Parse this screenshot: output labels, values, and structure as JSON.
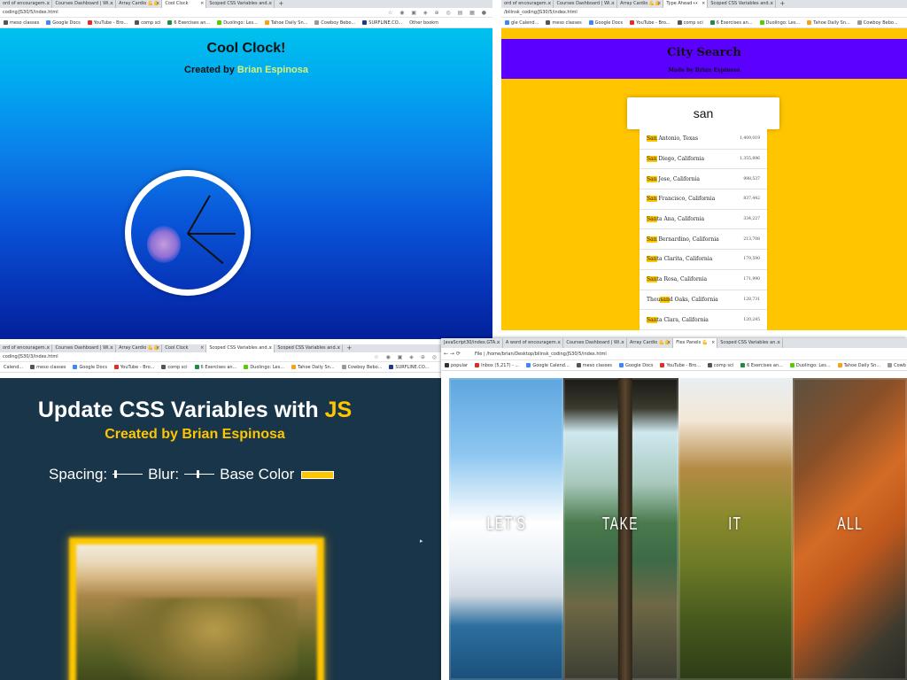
{
  "clock_window": {
    "tabs": [
      "ord of encouragem...",
      "Courses Dashboard | Wi...",
      "Array Cardio 💪💪",
      "Cool Clock",
      "Scoped CSS Variables and..."
    ],
    "active_tab": "Cool Clock",
    "url": "coding/JS30/5/index.html",
    "bookmarks": [
      "meso classes",
      "Google Docs",
      "YouTube - Bro...",
      "comp sci",
      "6 Exercises an...",
      "Duolingo: Les...",
      "Tahoe Daily Sn...",
      "Cowboy Bebo...",
      "SURFLINE.CO...",
      "Other bookm"
    ],
    "title": "Cool Clock!",
    "subtitle_prefix": "Created by ",
    "subtitle_name": "Brian Espinosa",
    "clock": {
      "hour_deg": -60,
      "minute_deg": 0,
      "second_deg": 40
    }
  },
  "city_window": {
    "tabs": [
      "ord of encouragem...",
      "Courses Dashboard | Wi...",
      "Array Cardio 💪💪",
      "Type Ahead 👀",
      "Scoped CSS Variables and..."
    ],
    "active_tab": "Type Ahead 👀",
    "url": "/bilinsk_coding/JS30/5/index.html",
    "bookmarks": [
      "gle Calend...",
      "meso classes",
      "Google Docs",
      "YouTube - Bro...",
      "comp sci",
      "6 Exercises an...",
      "Duolingo: Les...",
      "Tahoe Daily Sn...",
      "Cowboy Bebo..."
    ],
    "title": "City Search",
    "subtitle": "Made by Brian Espinosa",
    "search_value": "san",
    "results": [
      {
        "before": "",
        "match": "San",
        "after": " Antonio, Texas",
        "pop": "1,409,019"
      },
      {
        "before": "",
        "match": "San",
        "after": " Diego, California",
        "pop": "1,355,896"
      },
      {
        "before": "",
        "match": "San",
        "after": " Jose, California",
        "pop": "998,537"
      },
      {
        "before": "",
        "match": "San",
        "after": " Francisco, California",
        "pop": "837,442"
      },
      {
        "before": "",
        "match": "San",
        "after": "ta Ana, California",
        "pop": "334,227"
      },
      {
        "before": "",
        "match": "San",
        "after": " Bernardino, California",
        "pop": "213,708"
      },
      {
        "before": "",
        "match": "San",
        "after": "ta Clarita, California",
        "pop": "179,590"
      },
      {
        "before": "",
        "match": "San",
        "after": "ta Rosa, California",
        "pop": "171,990"
      },
      {
        "before": "Thou",
        "match": "san",
        "after": "d Oaks, California",
        "pop": "128,731"
      },
      {
        "before": "",
        "match": "San",
        "after": "ta Clara, California",
        "pop": "120,245"
      }
    ]
  },
  "vars_window": {
    "tabs": [
      "ord of encouragem...",
      "Courses Dashboard | Wi...",
      "Array Cardio 💪💪",
      "Cool Clock",
      "Scoped CSS Variables and...",
      "Scoped CSS Variables and..."
    ],
    "active_tab": "Scoped CSS Variables and...",
    "url": "coding/JS30/3/index.html",
    "bookmarks": [
      "Calend...",
      "meso classes",
      "Google Docs",
      "YouTube - Bro...",
      "comp sci",
      "6 Exercises an...",
      "Duolingo: Les...",
      "Tahoe Daily Sn...",
      "Cowboy Bebo...",
      "SURFLINE.CO..."
    ],
    "title_main": "Update CSS Variables with ",
    "title_js": "JS",
    "subtitle": "Created by Brian Espinosa",
    "spacing_label": "Spacing:",
    "blur_label": "Blur:",
    "base_color_label": "Base Color",
    "base_color": "#ffc600",
    "spacing_value": 0.05,
    "blur_value": 0.45
  },
  "flex_window": {
    "tabs": [
      "JavaScript30/index.GTA...",
      "A word of encouragem...",
      "Courses Dashboard | Wi...",
      "Array Cardio 💪💪",
      "Flex Panels 💪",
      "Scoped CSS Variables an..."
    ],
    "active_tab": "Flex Panels 💪",
    "url_prefix": "File | ",
    "url": "/home/brian/Desktop/bilinsk_coding/JS30/5/index.html",
    "bookmarks": [
      "popular",
      "Inbox (5,217) - ...",
      "Google Calend...",
      "meso classes",
      "Google Docs",
      "YouTube - Bro...",
      "comp sci",
      "6 Exercises an...",
      "Duolingo: Les...",
      "Tahoe Daily Sn...",
      "Cowb"
    ],
    "panels": [
      "LET'S",
      "TAKE",
      "IT",
      "ALL"
    ]
  }
}
